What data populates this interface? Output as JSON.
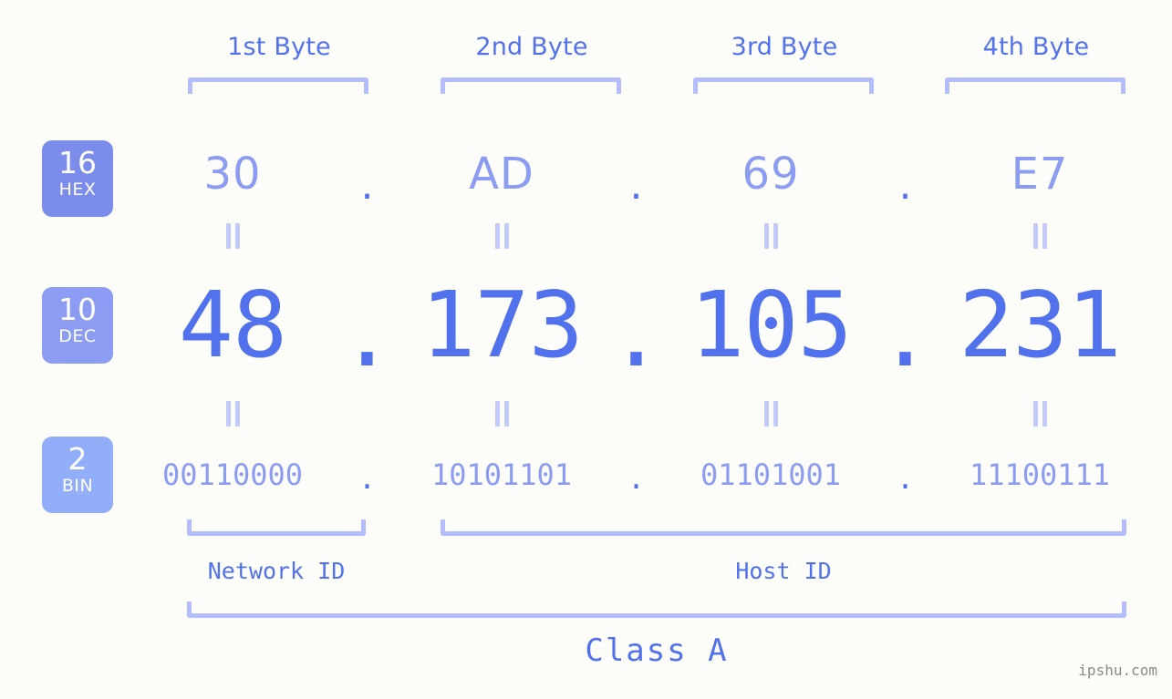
{
  "header": {
    "byte_labels": [
      "1st Byte",
      "2nd Byte",
      "3rd Byte",
      "4th Byte"
    ]
  },
  "bases": [
    {
      "number": "16",
      "name": "HEX",
      "color": "#7b8ceb"
    },
    {
      "number": "10",
      "name": "DEC",
      "color": "#8b9cf2"
    },
    {
      "number": "2",
      "name": "BIN",
      "color": "#93aef9"
    }
  ],
  "separator": ".",
  "rows": {
    "hex": {
      "values": [
        "30",
        "AD",
        "69",
        "E7"
      ]
    },
    "dec": {
      "values": [
        "48",
        "173",
        "105",
        "231"
      ]
    },
    "bin": {
      "values": [
        "00110000",
        "10101101",
        "01101001",
        "11100111"
      ]
    }
  },
  "equals_symbol": "||",
  "sections": {
    "network_id": "Network ID",
    "host_id": "Host ID",
    "class": "Class A"
  },
  "watermark": "ipshu.com",
  "colors": {
    "background": "#fcfdf8",
    "accent_strong": "#5271ed",
    "accent_mid": "#8b9cf2",
    "accent_light": "#b4bdfb"
  }
}
